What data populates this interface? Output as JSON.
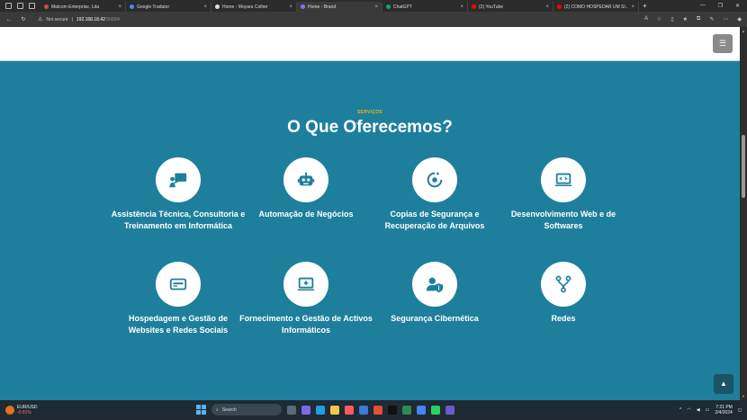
{
  "browser": {
    "tabs": [
      {
        "title": "Matcom Enterprise, Lda",
        "favicon": "#d04a4a"
      },
      {
        "title": "Google Tradutor",
        "favicon": "#4a8af4"
      },
      {
        "title": "Home - Moyara Colher",
        "favicon": "#dddddd"
      },
      {
        "title": "Home - Brand",
        "favicon": "#8e6cf0",
        "active": true
      },
      {
        "title": "ChatGPT",
        "favicon": "#10a37f"
      },
      {
        "title": "(2) YouTube",
        "favicon": "#ff0000"
      },
      {
        "title": "(2) COMO HOSPEDAR UM SI...",
        "favicon": "#ff0000"
      }
    ],
    "security_label": "Not secure",
    "url_host": "192.168.18.42",
    "url_rest": ":5020/#"
  },
  "page": {
    "kicker": "SERVIÇOS",
    "title": "O Que Oferecemos?",
    "services": [
      {
        "label": "Assistência Técnica, Consultoria e Treinamento em Informática",
        "icon": "presentation-icon"
      },
      {
        "label": "Automação de Negócios",
        "icon": "robot-icon"
      },
      {
        "label": "Copias de Segurança e Recuperação de Arquivos",
        "icon": "backup-icon"
      },
      {
        "label": "Desenvolvimento Web e de Softwares",
        "icon": "code-laptop-icon"
      },
      {
        "label": "Hospedagem e Gestão de Websites e Redes Sociais",
        "icon": "server-icon"
      },
      {
        "label": "Fornecimento e Gestão de Activos Informáticos",
        "icon": "laptop-plus-icon"
      },
      {
        "label": "Segurança Cibernética",
        "icon": "user-shield-icon"
      },
      {
        "label": "Redes",
        "icon": "network-icon"
      }
    ],
    "accent": "#f1b316",
    "background": "#1e7f9c"
  },
  "taskbar": {
    "ticker": "EUR/USD",
    "ticker_change": "-0.81%",
    "search_label": "Search",
    "time": "7:21 PM",
    "date": "2/4/2024"
  }
}
